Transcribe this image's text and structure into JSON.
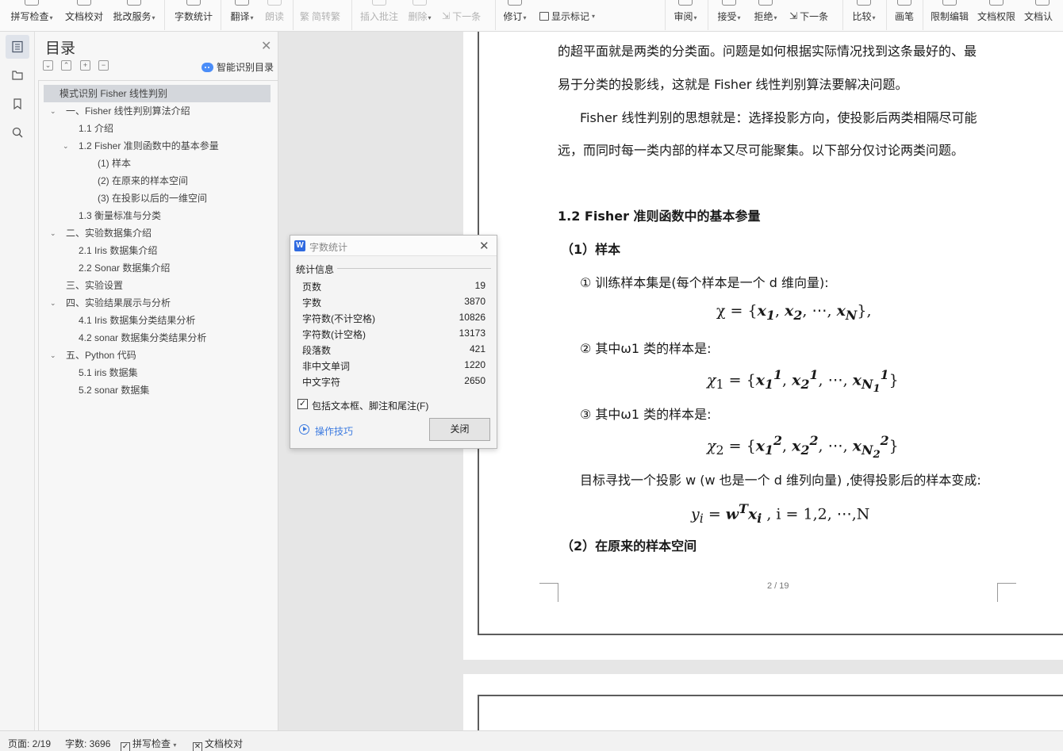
{
  "ribbon": {
    "spellcheck": "拼写检查",
    "doc_proof": "文档校对",
    "correction_service": "批改服务",
    "word_count": "字数统计",
    "translate": "翻译",
    "read_aloud": "朗读",
    "simp_trad": "简转繁",
    "insert_comment": "插入批注",
    "delete": "删除",
    "next_comment": "下一条",
    "revise": "修订",
    "show_markup": "显示标记",
    "review": "审阅",
    "accept": "接受",
    "reject": "拒绝",
    "next_change": "下一条",
    "compare": "比较",
    "pen": "画笔",
    "restrict_edit": "限制编辑",
    "doc_permission": "文档权限",
    "doc_authenticate": "文档认"
  },
  "toc": {
    "title": "目录",
    "smart_label": "智能识别目录",
    "items": [
      {
        "text": "模式识别  Fisher 线性判别",
        "level": 0,
        "selected": true,
        "chevron": ""
      },
      {
        "text": "一、Fisher 线性判别算法介绍",
        "level": 1,
        "chevron": "open"
      },
      {
        "text": "1.1  介绍",
        "level": 2,
        "chevron": ""
      },
      {
        "text": "1.2 Fisher 准则函数中的基本参量",
        "level": 2,
        "chevron": "open"
      },
      {
        "text": "(1)  样本",
        "level": 3,
        "chevron": ""
      },
      {
        "text": "(2)  在原来的样本空间",
        "level": 3,
        "chevron": ""
      },
      {
        "text": "(3)  在投影以后的一维空间",
        "level": 3,
        "chevron": ""
      },
      {
        "text": "1.3  衡量标准与分类",
        "level": 2,
        "chevron": ""
      },
      {
        "text": "二、实验数据集介绍",
        "level": 1,
        "chevron": "open"
      },
      {
        "text": "2.1 Iris 数据集介绍",
        "level": 2,
        "chevron": ""
      },
      {
        "text": "2.2 Sonar 数据集介绍",
        "level": 2,
        "chevron": ""
      },
      {
        "text": "三、实验设置",
        "level": 1,
        "chevron": ""
      },
      {
        "text": "四、实验结果展示与分析",
        "level": 1,
        "chevron": "open"
      },
      {
        "text": "4.1 Iris 数据集分类结果分析",
        "level": 2,
        "chevron": ""
      },
      {
        "text": "4.2 sonar 数据集分类结果分析",
        "level": 2,
        "chevron": ""
      },
      {
        "text": "五、Python 代码",
        "level": 1,
        "chevron": "open"
      },
      {
        "text": "5.1 iris 数据集",
        "level": 2,
        "chevron": ""
      },
      {
        "text": "5.2 sonar 数据集",
        "level": 2,
        "chevron": ""
      }
    ]
  },
  "document": {
    "p1": "的超平面就是两类的分类面。问题是如何根据实际情况找到这条最好的、最",
    "p2": "易于分类的投影线，这就是 Fisher 线性判别算法要解决问题。",
    "p3": "Fisher 线性判别的思想就是：选择投影方向，使投影后两类相隔尽可能",
    "p4": "远，而同时每一类内部的样本又尽可能聚集。以下部分仅讨论两类问题。",
    "h1": "1.2 Fisher 准则函数中的基本参量",
    "h2": "（1）样本",
    "item1": "① 训练样本集是(每个样本是一个 d 维向量):",
    "item2": "② 其中ω1 类的样本是:",
    "item3": "③ 其中ω1 类的样本是:",
    "target": "目标寻找一个投影 w (w 也是一个 d 维列向量) ,使得投影后的样本变成:",
    "h3": "（2）在原来的样本空间",
    "page_number": "2 / 19"
  },
  "dialog": {
    "title": "字数统计",
    "section": "统计信息",
    "stats": [
      {
        "label": "页数",
        "value": "19"
      },
      {
        "label": "字数",
        "value": "3870"
      },
      {
        "label": "字符数(不计空格)",
        "value": "10826"
      },
      {
        "label": "字符数(计空格)",
        "value": "13173"
      },
      {
        "label": "段落数",
        "value": "421"
      },
      {
        "label": "非中文单词",
        "value": "1220"
      },
      {
        "label": "中文字符",
        "value": "2650"
      }
    ],
    "include_checkbox": "包括文本框、脚注和尾注(F)",
    "include_checked": true,
    "tips": "操作技巧",
    "close": "关闭"
  },
  "status": {
    "page": "页面: 2/19",
    "words": "字数: 3696",
    "spellcheck": "拼写检查",
    "doc_proof": "文档校对"
  },
  "colors": {
    "accent": "#2f6ae0",
    "link": "#3d7be0",
    "toc_selected": "#d4d7dc"
  }
}
